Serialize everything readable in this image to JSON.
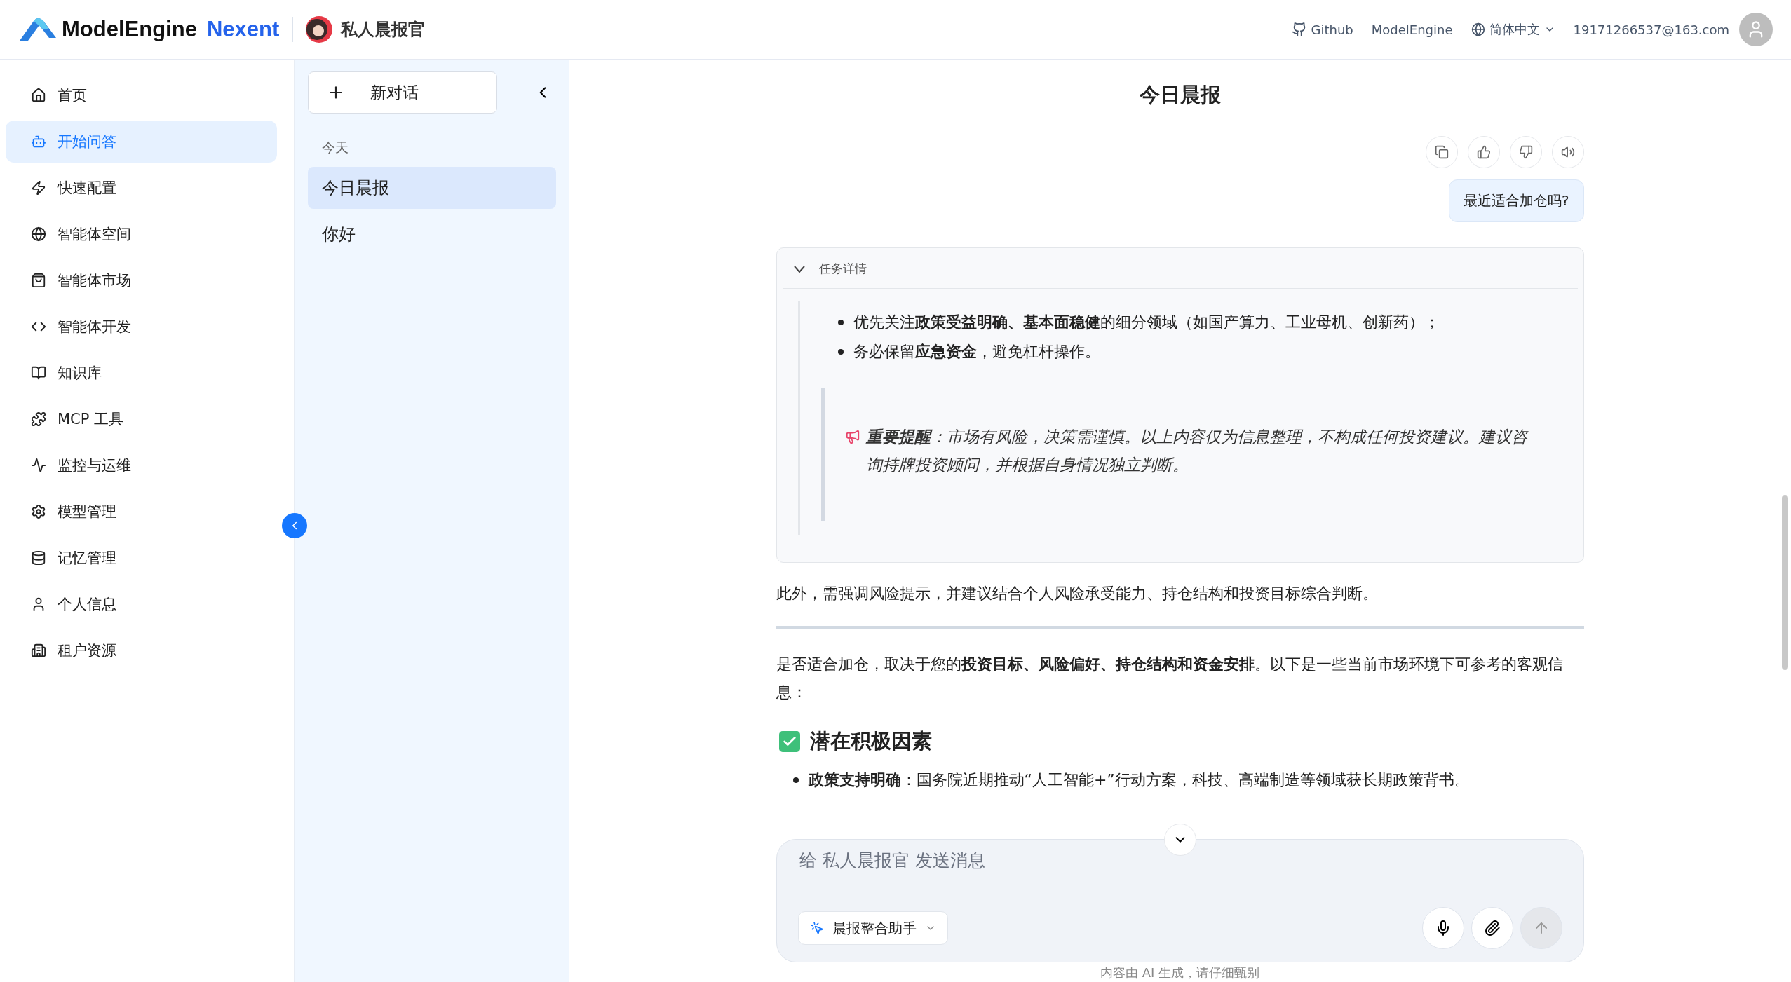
{
  "header": {
    "brand": "ModelEngine",
    "product": "Nexent",
    "agent": "私人晨报官",
    "links": [
      "Github",
      "ModelEngine"
    ],
    "language": "简体中文",
    "user": "19171266537@163.com"
  },
  "nav": [
    {
      "label": "首页",
      "selected": false
    },
    {
      "label": "开始问答",
      "selected": true
    },
    {
      "label": "快速配置",
      "selected": false
    },
    {
      "label": "智能体空间",
      "selected": false
    },
    {
      "label": "智能体市场",
      "selected": false
    },
    {
      "label": "智能体开发",
      "selected": false
    },
    {
      "label": "知识库",
      "selected": false
    },
    {
      "label": "MCP 工具",
      "selected": false
    },
    {
      "label": "监控与运维",
      "selected": false
    },
    {
      "label": "模型管理",
      "selected": false
    },
    {
      "label": "记忆管理",
      "selected": false
    },
    {
      "label": "个人信息",
      "selected": false
    },
    {
      "label": "租户资源",
      "selected": false
    }
  ],
  "conversations": {
    "new_button": "新对话",
    "groups": [
      {
        "label": "今天",
        "items": [
          {
            "title": "今日晨报",
            "selected": true
          },
          {
            "title": "你好",
            "selected": false
          }
        ]
      }
    ]
  },
  "chat": {
    "title": "今日晨报",
    "user_message": "最近适合加仓吗?",
    "task_details": {
      "label": "任务详情",
      "expanded": true,
      "bullets": [
        "优先关注**政策受益明确、基本面稳健**的细分领域（如国产算力、工业母机、创新药）；",
        "务必保留**应急资金**，避免杠杆操作。"
      ],
      "notice": "**重要提醒**：市场有风险，决策需谨慎。以上内容仅为信息整理，不构成任何投资建议。建议咨询持牌投资顾问，并根据自身情况独立判断。"
    },
    "blocks": [
      {
        "kind": "paragraph",
        "text": "此外，需强调风险提示，并建议结合个人风险承受能力、持仓结构和投资目标综合判断。"
      },
      {
        "kind": "rule"
      },
      {
        "kind": "paragraph",
        "text": "是否适合加仓，取决于您的**投资目标、风险偏好、持仓结构和资金安排**。以下是一些当前市场环境下可参考的客观信息："
      },
      {
        "kind": "heading",
        "text": "潜在积极因素"
      },
      {
        "kind": "bullets",
        "items": [
          "**政策支持明确**：国务院近期推动“人工智能+”行动方案，科技、高端制造等领域获长期政策背书。"
        ]
      }
    ]
  },
  "composer": {
    "placeholder": "给 私人晨报官 发送消息",
    "agent": "晨报整合助手",
    "footer": "内容由 AI 生成，请仔细甄别"
  }
}
